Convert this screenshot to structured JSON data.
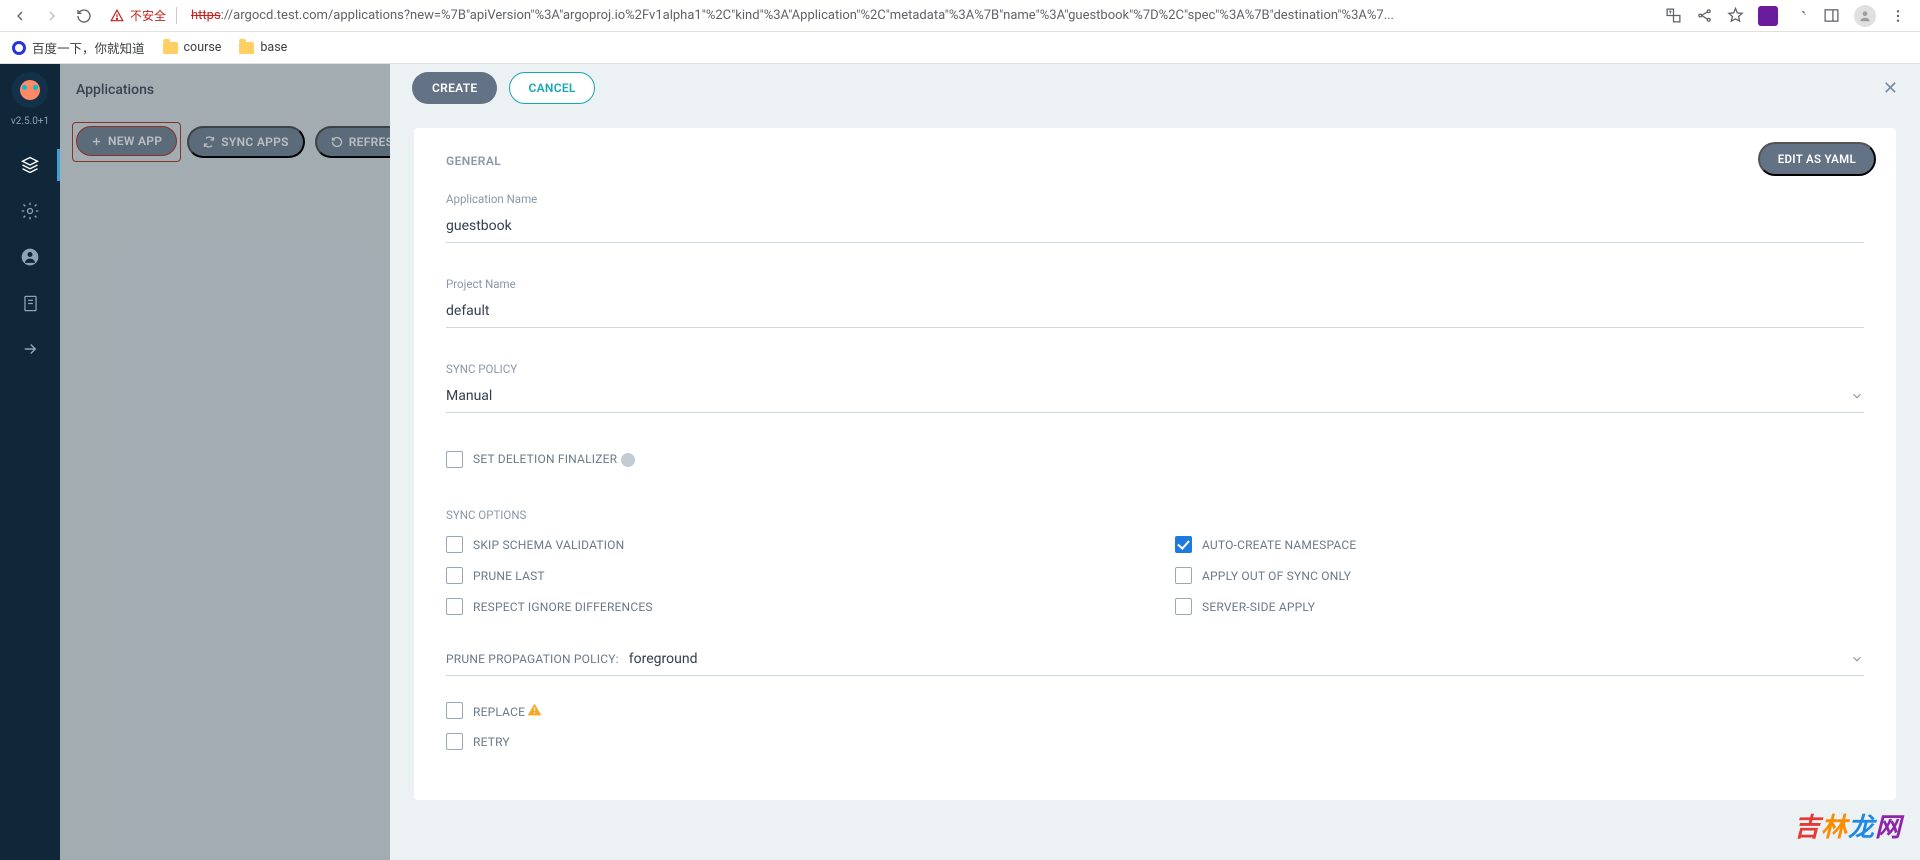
{
  "browser": {
    "security_label": "不安全",
    "url_protocol": "https",
    "url_rest": "://argocd.test.com/applications?new=%7B\"apiVersion\"%3A\"argoproj.io%2Fv1alpha1\"%2C\"kind\"%3A\"Application\"%2C\"metadata\"%3A%7B\"name\"%3A\"guestbook\"%7D%2C\"spec\"%3A%7B\"destination\"%3A%7...",
    "bookmarks": [
      {
        "label": "百度一下，你就知道",
        "icon": "baidu"
      },
      {
        "label": "course",
        "icon": "folder"
      },
      {
        "label": "base",
        "icon": "folder"
      }
    ]
  },
  "sidebar": {
    "version": "v2.5.0+1"
  },
  "page": {
    "title": "Applications",
    "buttons": {
      "new_app": "NEW APP",
      "sync_apps": "SYNC APPS",
      "refresh": "REFRESH"
    }
  },
  "panel": {
    "create": "CREATE",
    "cancel": "CANCEL",
    "edit_yaml": "EDIT AS YAML",
    "section_general": "GENERAL",
    "fields": {
      "app_name_label": "Application Name",
      "app_name_value": "guestbook",
      "project_label": "Project Name",
      "project_value": "default"
    },
    "sync_policy": {
      "label": "SYNC POLICY",
      "value": "Manual"
    },
    "finalizer": {
      "label": "SET DELETION FINALIZER",
      "checked": false
    },
    "sync_options": {
      "label": "SYNC OPTIONS",
      "left": [
        {
          "label": "SKIP SCHEMA VALIDATION",
          "checked": false
        },
        {
          "label": "PRUNE LAST",
          "checked": false
        },
        {
          "label": "RESPECT IGNORE DIFFERENCES",
          "checked": false
        }
      ],
      "right": [
        {
          "label": "AUTO-CREATE NAMESPACE",
          "checked": true
        },
        {
          "label": "APPLY OUT OF SYNC ONLY",
          "checked": false
        },
        {
          "label": "SERVER-SIDE APPLY",
          "checked": false
        }
      ]
    },
    "prune": {
      "label": "PRUNE PROPAGATION POLICY:",
      "value": "foreground"
    },
    "replace": {
      "label": "REPLACE",
      "checked": false
    },
    "retry": {
      "label": "RETRY",
      "checked": false
    }
  },
  "watermark": {
    "a": "吉",
    "b": "林",
    "c": "龙",
    "d": "网"
  }
}
